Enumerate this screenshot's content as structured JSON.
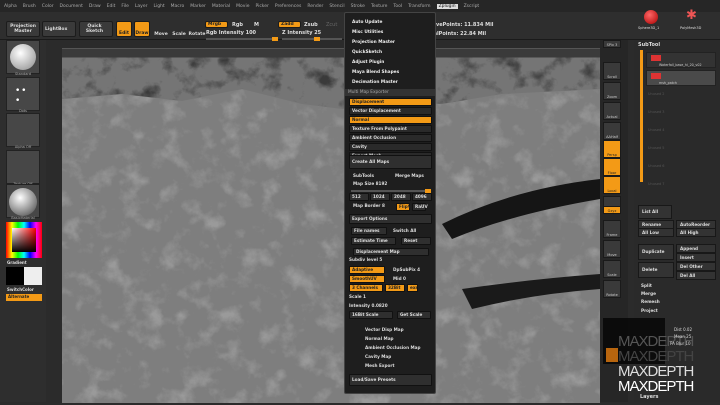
{
  "menu": [
    "Alpha",
    "Brush",
    "Color",
    "Document",
    "Draw",
    "Edit",
    "File",
    "Layer",
    "Light",
    "Macro",
    "Marker",
    "Material",
    "Movie",
    "Picker",
    "Preferences",
    "Render",
    "Stencil",
    "Stroke",
    "Texture",
    "Tool",
    "Transform",
    "Zplugin",
    "Zscript"
  ],
  "toolbar": {
    "projection_master": "Projection Master",
    "lightbox": "LightBox",
    "quick_sketch": "Quick Sketch",
    "edit": "Edit",
    "draw": "Draw",
    "move": "Move",
    "scale": "Scale",
    "rotate": "Rotate",
    "mrgb": "Mrgb",
    "rgb": "Rgb",
    "m": "M",
    "rgb_intensity": "Rgb Intensity 100",
    "zadd": "Zadd",
    "zsub": "Zsub",
    "zcut": "Zcut",
    "z_intensity": "Z Intensity 25",
    "active_points": "ActivePoints: 11.834 Mil",
    "total_points": "TotalPoints: 22.84 Mil"
  },
  "left": {
    "tiles": [
      "Standard",
      "Dots",
      "Alpha Off",
      "Texture Off",
      "BasicMaterial"
    ],
    "gradient": "Gradient",
    "switch_color": "SwitchColor",
    "alternate": "Alternate"
  },
  "zplugin": {
    "top_items": [
      "Auto Update",
      "Misc Utilities",
      "Projection Master",
      "QuickSketch",
      "Adjust Plugin",
      "Maya Blend Shapes",
      "Decimation Master"
    ],
    "header": "Multi Map Exporter",
    "maps": [
      {
        "label": "Displacement",
        "on": true
      },
      {
        "label": "Vector Displacement",
        "on": false
      },
      {
        "label": "Normal",
        "on": true
      },
      {
        "label": "Texture From Polypaint",
        "on": false
      },
      {
        "label": "Ambient Occlusion",
        "on": false
      },
      {
        "label": "Cavity",
        "on": false
      },
      {
        "label": "Export Mesh",
        "on": false
      }
    ],
    "create_all": "Create All Maps",
    "subtools": "SubTools",
    "merge_maps": "Merge Maps",
    "map_size": "Map Size 8192",
    "sizes": [
      "512",
      "1024",
      "2048",
      "4096"
    ],
    "map_border": "Map Border 8",
    "flipv": "FlipV",
    "rauv": "RaUV",
    "export_options": "Export Options",
    "file_names": "File names",
    "switch_all": "Switch All",
    "estimate_time": "Estimate Time",
    "reset": "Reset",
    "disp_map": "Displacement Map",
    "subdiv": "Subdiv level 5",
    "adaptive": "Adaptive",
    "dpsubpix": "DpSubPix 4",
    "smoothuv": "SmoothUV",
    "mid": "Mid 0",
    "channels": "3 Channels",
    "bit": "32Bit",
    "exr": "exr",
    "scale": "Scale 1",
    "intensity": "Intensity 0.0820",
    "scale16": "16Bit Scale",
    "get_scale": "Get Scale",
    "sub_maps": [
      "Vector Disp Map",
      "Normal Map",
      "Ambient Occlusion Map",
      "Cavity Map",
      "Mesh Export"
    ],
    "load_save": "Load/Save Presets"
  },
  "right_shelf": [
    "SPix 3",
    "Scroll",
    "Zoom",
    "Actual",
    "AAHalf",
    "Persp",
    "Floor",
    "Local",
    "L.Sym",
    "Gxyz",
    "Frame",
    "Move",
    "Scale",
    "Rotate"
  ],
  "subtool": {
    "tools": [
      "Sphere3D_1",
      "PolyMesh3D"
    ],
    "title": "SubTool",
    "items": [
      "Waterfall_base_hi_20_v02",
      "msh_patch"
    ],
    "slots": [
      "Unused 2",
      "Unused 3",
      "Unused 4",
      "Unused 5",
      "Unused 6",
      "Unused 7"
    ],
    "buttons": [
      "List All",
      "Rename",
      "AutoReorder",
      "All Low",
      "All High",
      "Duplicate",
      "Append",
      "Insert",
      "Delete",
      "Del Other",
      "Del All",
      "Split",
      "Merge",
      "Remesh",
      "Project"
    ],
    "dist": "Dist 0.02",
    "mean": "Mean 25",
    "pa_blur": "PA Blur 10",
    "layers": "Layers"
  },
  "watermark": "MAXDEPTH",
  "colors": {
    "accent": "#f39a16"
  }
}
